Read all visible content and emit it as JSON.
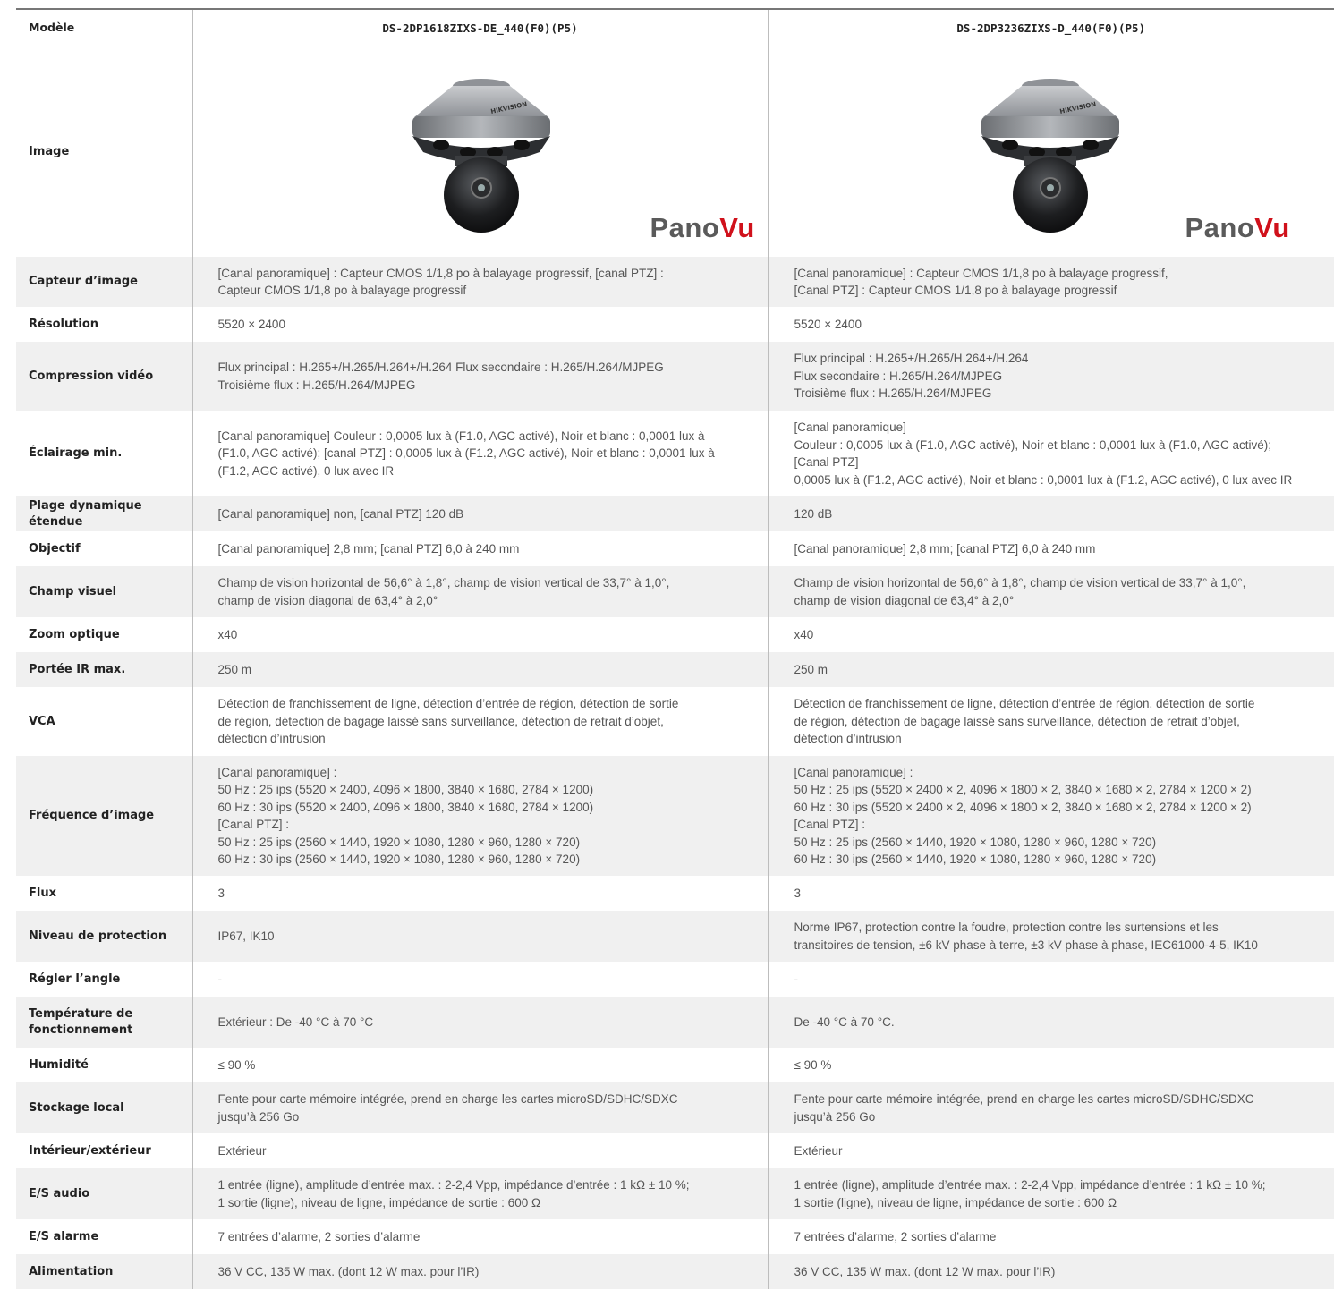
{
  "header": {
    "label": "Modèle",
    "model1": "DS-2DP1618ZIXS-DE_440(F0)(P5)",
    "model2": "DS-2DP3236ZIXS-D_440(F0)(P5)"
  },
  "image_row": {
    "label": "Image",
    "brand_text": "HIKVISION",
    "logo_pano": "Pano",
    "logo_vu": "Vu"
  },
  "rows": [
    {
      "label": "Capteur d’image",
      "v1": "[Canal panoramique] : Capteur CMOS 1/1,8 po à balayage progressif, [canal PTZ] :\nCapteur CMOS 1/1,8 po à balayage progressif",
      "v2": "[Canal panoramique] : Capteur CMOS 1/1,8 po à balayage progressif,\n[Canal PTZ] : Capteur CMOS 1/1,8 po à balayage progressif"
    },
    {
      "label": "Résolution",
      "v1": "5520 × 2400",
      "v2": "5520 × 2400"
    },
    {
      "label": "Compression vidéo",
      "v1": "Flux principal : H.265+/H.265/H.264+/H.264 Flux secondaire : H.265/H.264/MJPEG\nTroisième flux : H.265/H.264/MJPEG",
      "v2": "Flux principal : H.265+/H.265/H.264+/H.264\nFlux secondaire : H.265/H.264/MJPEG\nTroisième flux : H.265/H.264/MJPEG"
    },
    {
      "label": "Éclairage min.",
      "v1": "[Canal panoramique] Couleur : 0,0005 lux à (F1.0, AGC activé), Noir et blanc : 0,0001 lux à\n(F1.0, AGC activé); [canal PTZ] : 0,0005 lux à (F1.2, AGC activé), Noir et blanc : 0,0001 lux à\n(F1.2, AGC activé), 0 lux avec IR",
      "v2": "[Canal panoramique]\nCouleur : 0,0005 lux à (F1.0, AGC activé), Noir et blanc : 0,0001 lux à (F1.0, AGC activé);\n[Canal PTZ]\n0,0005 lux à (F1.2, AGC activé), Noir et blanc : 0,0001 lux à (F1.2, AGC activé), 0 lux avec IR"
    },
    {
      "label": "Plage dynamique étendue",
      "v1": "[Canal panoramique] non, [canal PTZ] 120 dB",
      "v2": "120 dB"
    },
    {
      "label": "Objectif",
      "v1": "[Canal panoramique] 2,8 mm; [canal PTZ] 6,0 à 240 mm",
      "v2": "[Canal panoramique] 2,8 mm; [canal PTZ] 6,0 à 240 mm"
    },
    {
      "label": "Champ visuel",
      "v1": "Champ de vision horizontal de 56,6° à 1,8°, champ de vision vertical de 33,7° à 1,0°,\nchamp de vision diagonal de 63,4° à 2,0°",
      "v2": "Champ de vision horizontal de 56,6° à 1,8°, champ de vision vertical de 33,7° à 1,0°,\nchamp de vision diagonal de 63,4° à 2,0°"
    },
    {
      "label": "Zoom optique",
      "v1": "x40",
      "v2": "x40"
    },
    {
      "label": "Portée IR max.",
      "v1": "250 m",
      "v2": "250 m"
    },
    {
      "label": "VCA",
      "v1": "Détection de franchissement de ligne, détection d’entrée de région, détection de sortie\nde région, détection de bagage laissé sans surveillance, détection de retrait d’objet,\ndétection d’intrusion",
      "v2": "Détection de franchissement de ligne, détection d’entrée de région, détection de sortie\nde région, détection de bagage laissé sans surveillance, détection de retrait d’objet,\ndétection d’intrusion"
    },
    {
      "label": "Fréquence d’image",
      "v1": "[Canal panoramique] :\n50 Hz : 25 ips (5520 × 2400, 4096 × 1800, 3840 × 1680, 2784 × 1200)\n60 Hz : 30 ips (5520 × 2400, 4096 × 1800, 3840 × 1680, 2784 × 1200)\n[Canal PTZ] :\n50 Hz : 25 ips (2560 × 1440, 1920 × 1080, 1280 × 960, 1280 × 720)\n60 Hz : 30 ips (2560 × 1440, 1920 × 1080, 1280 × 960, 1280 × 720)",
      "v2": "[Canal panoramique] :\n50 Hz : 25 ips (5520 × 2400 × 2, 4096 × 1800 × 2, 3840 × 1680 × 2, 2784 × 1200 × 2)\n60 Hz : 30 ips (5520 × 2400 × 2, 4096 × 1800 × 2, 3840 × 1680 × 2, 2784 × 1200 × 2)\n[Canal PTZ] :\n50 Hz : 25 ips (2560 × 1440, 1920 × 1080, 1280 × 960, 1280 × 720)\n60 Hz : 30 ips (2560 × 1440, 1920 × 1080, 1280 × 960, 1280 × 720)"
    },
    {
      "label": "Flux",
      "v1": "3",
      "v2": "3"
    },
    {
      "label": "Niveau de protection",
      "v1": "IP67, IK10",
      "v2": "Norme IP67, protection contre la foudre, protection contre les surtensions et les\ntransitoires de tension, ±6 kV phase à terre, ±3 kV phase à phase, IEC61000-4-5, IK10"
    },
    {
      "label": "Régler l’angle",
      "v1": "-",
      "v2": "-"
    },
    {
      "label": "Température de\nfonctionnement",
      "v1": "Extérieur : De -40 °C à 70 °C",
      "v2": "De -40 °C à 70 °C."
    },
    {
      "label": "Humidité",
      "v1": "≤ 90 %",
      "v2": "≤ 90 %"
    },
    {
      "label": "Stockage local",
      "v1": "Fente pour carte mémoire intégrée, prend en charge les cartes microSD/SDHC/SDXC\njusqu’à 256 Go",
      "v2": "Fente pour carte mémoire intégrée, prend en charge les cartes microSD/SDHC/SDXC\njusqu’à 256 Go"
    },
    {
      "label": "Intérieur/extérieur",
      "v1": "Extérieur",
      "v2": "Extérieur"
    },
    {
      "label": "E/S audio",
      "v1": "1 entrée (ligne), amplitude d’entrée max. : 2-2,4 Vpp, impédance d’entrée : 1 kΩ ± 10 %;\n1 sortie (ligne), niveau de ligne, impédance de sortie : 600 Ω",
      "v2": "1 entrée (ligne), amplitude d’entrée max. : 2-2,4 Vpp, impédance d’entrée : 1 kΩ ± 10 %;\n1 sortie (ligne), niveau de ligne, impédance de sortie : 600 Ω"
    },
    {
      "label": "E/S alarme",
      "v1": "7 entrées d’alarme, 2 sorties d’alarme",
      "v2": "7 entrées d’alarme, 2 sorties d’alarme"
    },
    {
      "label": "Alimentation",
      "v1": "36 V CC, 135 W max. (dont 12 W max. pour l’IR)",
      "v2": "36 V CC, 135 W max. (dont 12 W max. pour l’IR)"
    }
  ]
}
